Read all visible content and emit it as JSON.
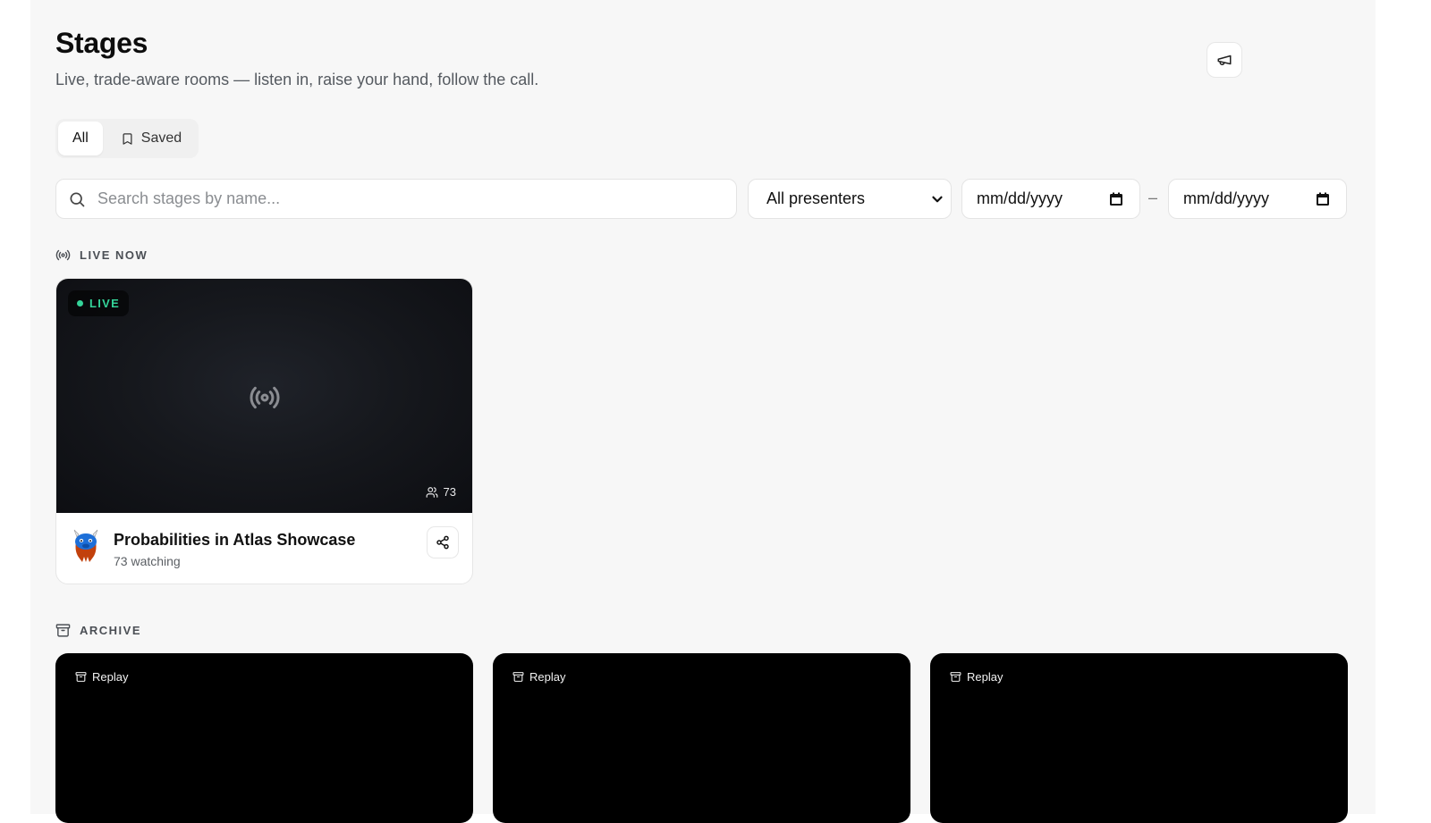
{
  "header": {
    "title": "Stages",
    "subtitle": "Live, trade-aware rooms — listen in, raise your hand, follow the call.",
    "announce_icon": "megaphone-icon"
  },
  "tabs": [
    {
      "label": "All",
      "active": true
    },
    {
      "label": "Saved",
      "icon": "bookmark-icon",
      "active": false
    }
  ],
  "filters": {
    "search_placeholder": "Search stages by name...",
    "presenter_selected": "All presenters",
    "date_from_placeholder": "mm/dd/yyyy",
    "date_to_placeholder": "mm/dd/yyyy",
    "date_separator": "–"
  },
  "live_section": {
    "label": "LIVE NOW",
    "icon": "broadcast-icon",
    "cards": [
      {
        "badge": "LIVE",
        "viewers": "73",
        "title": "Probabilities in Atlas Showcase",
        "watching": "73 watching",
        "accent_color": "#34d399"
      }
    ]
  },
  "archive_section": {
    "label": "ARCHIVE",
    "icon": "archive-icon",
    "cards": [
      {
        "badge": "Replay"
      },
      {
        "badge": "Replay"
      },
      {
        "badge": "Replay"
      }
    ]
  }
}
